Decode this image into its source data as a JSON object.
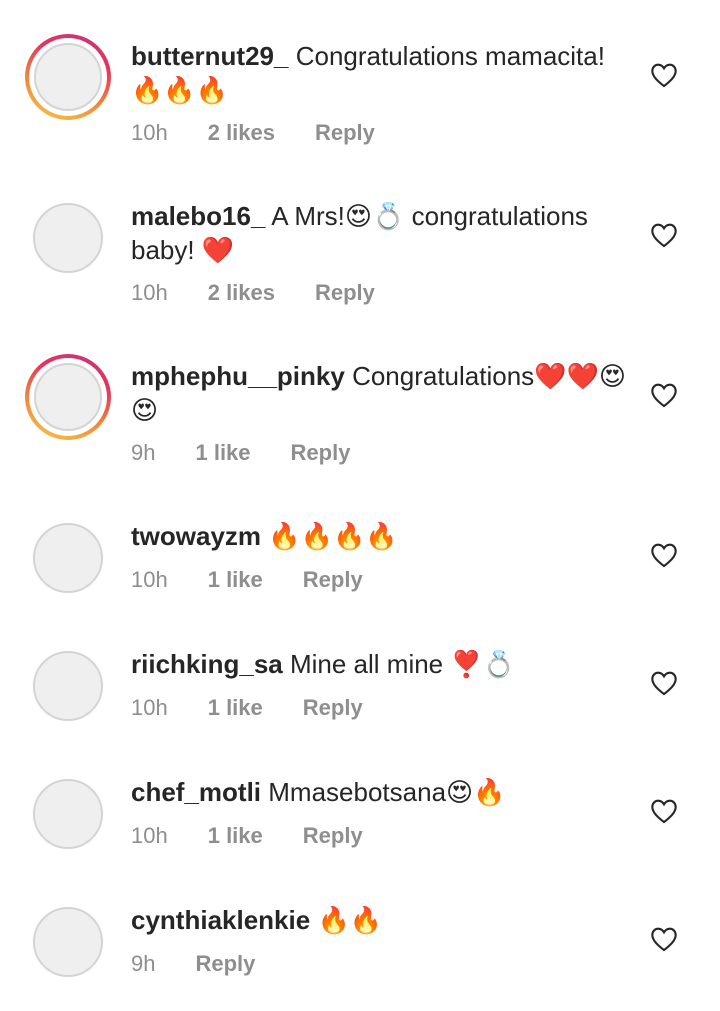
{
  "comments": [
    {
      "username": "butternut29_",
      "text": "Congratulations mamacita!",
      "emoji": "🔥🔥🔥",
      "time": "10h",
      "likes": "2 likes",
      "reply": "Reply",
      "story": true
    },
    {
      "username": "malebo16_",
      "text": "A Mrs!",
      "emoji": "😍💍",
      "text2": "congratulations baby!",
      "emoji2": "❤️",
      "time": "10h",
      "likes": "2 likes",
      "reply": "Reply",
      "story": false
    },
    {
      "username": "mphephu__pinky",
      "text": "Congratulations",
      "emoji": "❤️❤️😍😍",
      "time": "9h",
      "likes": "1 like",
      "reply": "Reply",
      "story": true
    },
    {
      "username": "twowayzm",
      "text": "",
      "emoji": "🔥🔥🔥🔥",
      "time": "10h",
      "likes": "1 like",
      "reply": "Reply",
      "story": false
    },
    {
      "username": "riichking_sa",
      "text": "Mine all mine",
      "emoji": "❣️💍",
      "time": "10h",
      "likes": "1 like",
      "reply": "Reply",
      "story": false
    },
    {
      "username": "chef_motli",
      "text": "Mmasebotsana",
      "emoji": "😍🔥",
      "time": "10h",
      "likes": "1 like",
      "reply": "Reply",
      "story": false
    },
    {
      "username": "cynthiaklenkie",
      "text": "",
      "emoji": "🔥🔥",
      "time": "9h",
      "likes": "",
      "reply": "Reply",
      "story": false
    }
  ]
}
